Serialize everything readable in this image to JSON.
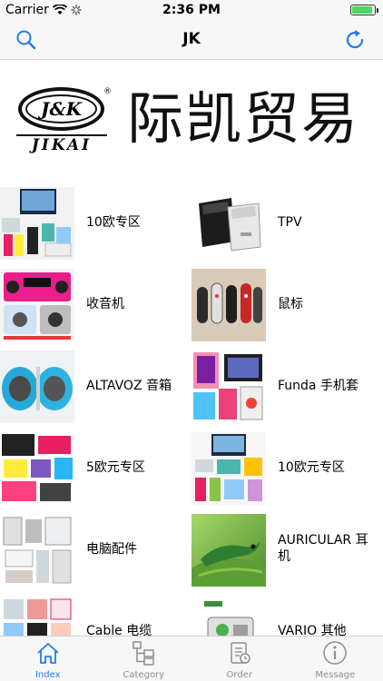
{
  "status": {
    "carrier": "Carrier",
    "time": "2:36 PM"
  },
  "nav": {
    "title": "JK"
  },
  "banner": {
    "logo_text": "J&K",
    "logo_sub": "JIKAI",
    "company_name": "际凯贸易"
  },
  "categories": [
    {
      "label": "10欧专区",
      "icon": "multi-products-thumb"
    },
    {
      "label": "TPV",
      "icon": "receipt-printer-thumb"
    },
    {
      "label": "收音机",
      "icon": "radio-thumb"
    },
    {
      "label": "鼠标",
      "icon": "mouse-thumb"
    },
    {
      "label": "ALTAVOZ 音箱",
      "icon": "speaker-thumb"
    },
    {
      "label": "Funda 手机套",
      "icon": "phone-case-thumb"
    },
    {
      "label": "5欧元专区",
      "icon": "power-bank-thumb"
    },
    {
      "label": "10欧元专区",
      "icon": "gadgets-thumb"
    },
    {
      "label": "电脑配件",
      "icon": "computer-accessories-thumb"
    },
    {
      "label": "AURICULAR 耳机",
      "icon": "lizard-thumb"
    },
    {
      "label": "Cable 电缆",
      "icon": "cable-thumb"
    },
    {
      "label": "VARIO 其他",
      "icon": "misc-thumb"
    }
  ],
  "tabs": [
    {
      "label": "Index",
      "icon": "home-icon",
      "active": true
    },
    {
      "label": "Category",
      "icon": "category-icon",
      "active": false
    },
    {
      "label": "Order",
      "icon": "order-icon",
      "active": false
    },
    {
      "label": "Message",
      "icon": "info-icon",
      "active": false
    }
  ],
  "colors": {
    "accent": "#1e7de9",
    "battery": "#4cd964"
  }
}
